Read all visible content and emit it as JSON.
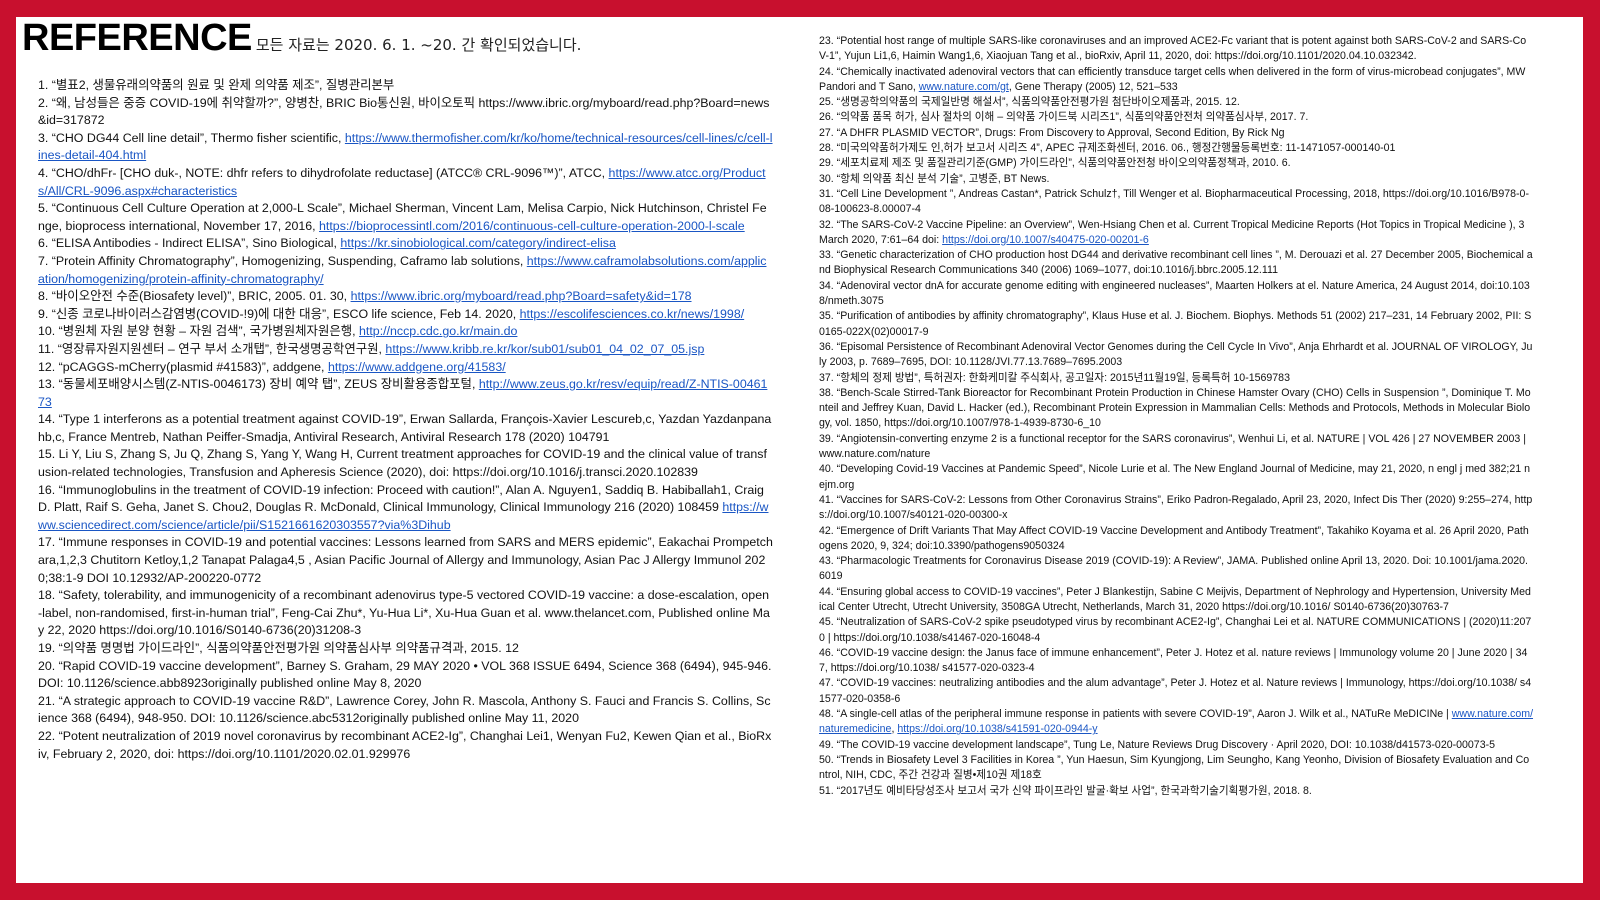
{
  "header": {
    "title": "REFERENCE",
    "subtitle": "모든 자료는 2020. 6. 1. ~20. 간 확인되었습니다."
  },
  "left_refs": [
    {
      "text": "1. “별표2, 생물유래의약품의 원료 및 완제 의약품 제조”, 질병관리본부",
      "link": ""
    },
    {
      "text": "2. “왜, 남성들은 중증 COVID-19에 취약할까?”, 양병찬, BRIC Bio통신원, 바이오토픽 https://www.ibric.org/myboard/read.php?Board=news&id=317872",
      "link": ""
    },
    {
      "text": "3. “CHO DG44 Cell line detail”, Thermo fisher scientific, ",
      "link": "https://www.thermofisher.com/kr/ko/home/technical-resources/cell-lines/c/cell-lines-detail-404.html"
    },
    {
      "text": "4. “CHO/dhFr- [CHO duk-, NOTE: dhfr refers to dihydrofolate reductase] (ATCC® CRL-9096™)”, ATCC, ",
      "link": "https://www.atcc.org/Products/All/CRL-9096.aspx#characteristics"
    },
    {
      "text": "5. “Continuous Cell Culture Operation at 2,000-L Scale”, Michael Sherman, Vincent Lam, Melisa Carpio, Nick Hutchinson, Christel Fenge, bioprocess international, November 17, 2016, ",
      "link": "https://bioprocessintl.com/2016/continuous-cell-culture-operation-2000-l-scale"
    },
    {
      "text": "6. “ELISA Antibodies - Indirect ELISA”, Sino Biological, ",
      "link": "https://kr.sinobiological.com/category/indirect-elisa"
    },
    {
      "text": "7. “Protein Affinity Chromatography”, Homogenizing, Suspending, Caframo lab solutions, ",
      "link": "https://www.caframolabsolutions.com/application/homogenizing/protein-affinity-chromatography/"
    },
    {
      "text": "8. “바이오안전 수준(Biosafety level)”, BRIC, 2005. 01. 30, ",
      "link": "https://www.ibric.org/myboard/read.php?Board=safety&id=178"
    },
    {
      "text": "9. “신종 코로나바이러스감염병(COVID-!9)에 대한 대응”, ESCO life science, Feb 14. 2020, ",
      "link": "https://escolifesciences.co.kr/news/1998/"
    },
    {
      "text": "10. “병원체 자원 분양 현황 – 자원 검색”, 국가병원체자원은행, ",
      "link": "http://nccp.cdc.go.kr/main.do"
    },
    {
      "text": "11. “영장류자원지원센터 – 연구 부서 소개탭”, 한국생명공학연구원, ",
      "link": "https://www.kribb.re.kr/kor/sub01/sub01_04_02_07_05.jsp"
    },
    {
      "text": "12. “pCAGGS-mCherry(plasmid #41583)”, addgene, ",
      "link": "https://www.addgene.org/41583/"
    },
    {
      "text": "13. “동물세포배양시스템(Z-NTIS-0046173) 장비 예약 탭”, ZEUS 장비활용종합포털, ",
      "link": "http://www.zeus.go.kr/resv/equip/read/Z-NTIS-0046173"
    },
    {
      "text": "14. “Type 1 interferons as a potential treatment against COVID-19”, Erwan Sallarda, François-Xavier Lescureb,c, Yazdan Yazdanpanahb,c, France Mentreb, Nathan Peiffer-Smadja, Antiviral Research, Antiviral Research 178 (2020) 104791",
      "link": ""
    },
    {
      "text": "15. Li Y, Liu S, Zhang S, Ju Q, Zhang S, Yang Y, Wang H, Current treatment approaches for COVID-19 and the clinical value of transfusion-related technologies, Transfusion and Apheresis Science (2020), doi: https://doi.org/10.1016/j.transci.2020.102839",
      "link": ""
    },
    {
      "text": "16. “Immunoglobulins in the treatment of COVID-19 infection: Proceed with caution!”, Alan A. Nguyen1, Saddiq B. Habiballah1, Craig D. Platt, Raif S. Geha, Janet S. Chou2, Douglas R. McDonald, Clinical Immunology, Clinical Immunology 216 (2020) 108459 ",
      "link": "https://www.sciencedirect.com/science/article/pii/S1521661620303557?via%3Dihub"
    },
    {
      "text": "17. “Immune responses in COVID-19 and potential vaccines: Lessons learned from SARS and MERS epidemic”, Eakachai Prompetchara,1,2,3 Chutitorn Ketloy,1,2 Tanapat Palaga4,5 , Asian Pacific Journal of Allergy and Immunology, Asian Pac J Allergy Immunol 2020;38:1-9 DOI 10.12932/AP-200220-0772",
      "link": ""
    },
    {
      "text": "18. “Safety, tolerability, and immunogenicity of a recombinant adenovirus type-5 vectored COVID-19 vaccine: a dose-escalation, open-label, non-randomised, first-in-human trial”, Feng-Cai Zhu*, Yu-Hua Li*, Xu-Hua Guan et al. www.thelancet.com, Published online May 22, 2020 https://doi.org/10.1016/S0140-6736(20)31208-3",
      "link": ""
    },
    {
      "text": "19. “의약품 명명법 가이드라인”, 식품의약품안전평가원 의약품심사부 의약품규격과, 2015. 12",
      "link": ""
    },
    {
      "text": "20. “Rapid COVID-19 vaccine development”, Barney S. Graham, 29 MAY 2020 • VOL 368 ISSUE 6494, Science 368 (6494), 945-946. DOI: 10.1126/science.abb8923originally published online May 8, 2020",
      "link": ""
    },
    {
      "text": "21. “A strategic approach to COVID-19 vaccine R&D”, Lawrence Corey, John R. Mascola, Anthony S. Fauci and Francis S. Collins, Science 368 (6494), 948-950. DOI: 10.1126/science.abc5312originally published online May 11, 2020",
      "link": ""
    },
    {
      "text": "22. “Potent neutralization of 2019 novel coronavirus by recombinant ACE2-Ig”, Changhai Lei1, Wenyan Fu2, Kewen Qian et al., BioRxiv, February 2, 2020, doi: https://doi.org/10.1101/2020.02.01.929976",
      "link": ""
    }
  ],
  "right_refs": [
    {
      "text": "23. “Potential host range of multiple SARS-like coronaviruses and an improved ACE2-Fc variant that is potent against both SARS-CoV-2 and SARS-CoV-1”, Yujun Li1,6, Haimin Wang1,6, Xiaojuan Tang et al., bioRxiv, April 11, 2020, doi: https://doi.org/10.1101/2020.04.10.032342.",
      "link": ""
    },
    {
      "text": "24. “Chemically inactivated adenoviral vectors that can efficiently transduce target cells when delivered in the form of virus-microbead conjugates”, MW Pandori and T Sano, ",
      "link": "www.nature.com/gt",
      "after": ", Gene Therapy (2005) 12, 521–533"
    },
    {
      "text": "25. “생명공학의약품의 국제일반명 해설서”, 식품의약품안전평가원 첨단바이오제품과, 2015. 12.",
      "link": ""
    },
    {
      "text": "26. “의약품 품목 허가, 심사 절차의 이해 – 의약품 가이드북 시리즈1”, 식품의약품안전처 의약품심사부, 2017. 7.",
      "link": ""
    },
    {
      "text": "27. “A DHFR PLASMID VECTOR”, Drugs: From Discovery to Approval, Second Edition, By Rick Ng",
      "link": ""
    },
    {
      "text": "28. “미국의약품허가제도 인,허가 보고서 시리즈 4”, APEC 규제조화센터, 2016. 06., 행정간행물등록번호: 11-1471057-000140-01",
      "link": ""
    },
    {
      "text": "29. “세포치료제 제조 및 품질관리기준(GMP) 가이드라인”, 식품의약품안전청 바이오의약품정책과, 2010. 6.",
      "link": ""
    },
    {
      "text": "30. “항체 의약품 최신 분석 기술”, 고병준, BT News.",
      "link": ""
    },
    {
      "text": "31. “Cell Line Development ”, Andreas Castan*, Patrick Schulz†, Till Wenger et al. Biopharmaceutical Processing, 2018, https://doi.org/10.1016/B978-0-08-100623-8.00007-4",
      "link": ""
    },
    {
      "text": "32. “The SARS-CoV-2 Vaccine Pipeline: an Overview”, Wen-Hsiang Chen et al. Current Tropical Medicine Reports (Hot Topics in Tropical Medicine ), 3 March 2020, 7:61–64 doi: ",
      "link": "https://doi.org/10.1007/s40475-020-00201-6"
    },
    {
      "text": "33. “Genetic characterization of CHO production host DG44 and derivative recombinant cell lines ”, M. Derouazi et al. 27 December 2005, Biochemical and Biophysical Research Communications 340 (2006) 1069–1077, doi:10.1016/j.bbrc.2005.12.111",
      "link": ""
    },
    {
      "text": "34. “Adenoviral vector dnA for accurate genome editing with engineered nucleases”, Maarten Holkers at el. Nature America, 24 August 2014, doi:10.1038/nmeth.3075",
      "link": ""
    },
    {
      "text": "35. “Purification of antibodies by affinity chromatography”, Klaus Huse et al. J. Biochem. Biophys. Methods 51 (2002) 217–231, 14 February 2002, PII: S0165-022X(02)00017-9",
      "link": ""
    },
    {
      "text": "36. “Episomal Persistence of Recombinant Adenoviral Vector Genomes during the Cell Cycle In Vivo”, Anja Ehrhardt et al. JOURNAL OF VIROLOGY, July 2003, p. 7689–7695, DOI: 10.1128/JVI.77.13.7689–7695.2003",
      "link": ""
    },
    {
      "text": "37. “항체의 정제 방법”, 특허권자: 한화케미칼 주식회사, 공고일자: 2015년11월19일, 등록특허 10-1569783",
      "link": ""
    },
    {
      "text": "38. “Bench-Scale Stirred-Tank Bioreactor for Recombinant Protein Production in Chinese Hamster Ovary (CHO) Cells in Suspension ”, Dominique T. Monteil and Jeffrey Kuan, David L. Hacker (ed.), Recombinant Protein Expression in Mammalian Cells: Methods and Protocols, Methods in Molecular Biology, vol. 1850, https://doi.org/10.1007/978-1-4939-8730-6_10",
      "link": ""
    },
    {
      "text": "39. “Angiotensin-converting enzyme 2 is a functional receptor for the SARS coronavirus”, Wenhui Li, et al. NATURE | VOL 426 | 27 NOVEMBER 2003 | www.nature.com/nature",
      "link": ""
    },
    {
      "text": "40. “Developing Covid-19 Vaccines at Pandemic Speed”, Nicole Lurie et al. The New England Journal of Medicine, may 21, 2020, n engl j med 382;21 nejm.org",
      "link": ""
    },
    {
      "text": "41. “Vaccines for SARS-CoV-2: Lessons from Other Coronavirus Strains”, Eriko Padron-Regalado, April 23, 2020, Infect Dis Ther (2020) 9:255–274, https://doi.org/10.1007/s40121-020-00300-x",
      "link": ""
    },
    {
      "text": "42. “Emergence of Drift Variants That May Affect COVID-19 Vaccine Development and Antibody Treatment”, Takahiko Koyama et al. 26 April 2020, Pathogens 2020, 9, 324; doi:10.3390/pathogens9050324",
      "link": ""
    },
    {
      "text": "43. “Pharmacologic Treatments for Coronavirus Disease 2019 (COVID-19): A Review”, JAMA. Published online April 13, 2020. Doi: 10.1001/jama.2020.6019",
      "link": ""
    },
    {
      "text": "44. “Ensuring global access to COVID-19 vaccines”, Peter J Blankestijn, Sabine C Meijvis, Department of Nephrology and Hypertension, University Medical Center Utrecht, Utrecht University, 3508GA Utrecht, Netherlands, March 31, 2020 https://doi.org/10.1016/ S0140-6736(20)30763-7",
      "link": ""
    },
    {
      "text": "45. “Neutralization of SARS-CoV-2 spike pseudotyped virus by recombinant ACE2-Ig”, Changhai Lei et al. NATURE COMMUNICATIONS | (2020)11:2070 | https://doi.org/10.1038/s41467-020-16048-4",
      "link": ""
    },
    {
      "text": "46. “COVID-19 vaccine design: the Janus face of immune enhancement”, Peter J. Hotez et al. nature reviews | Immunology volume 20 | June 2020 | 347, https://doi.org/10.1038/ s41577-020-0323-4",
      "link": ""
    },
    {
      "text": "47. “COVID-19 vaccines: neutralizing antibodies and the alum advantage”, Peter J. Hotez et al. Nature reviews | Immunology, https://doi.org/10.1038/ s41577-020-0358-6",
      "link": ""
    },
    {
      "text": "48. “A single-cell atlas of the peripheral immune response in patients with severe COVID-19”, Aaron J. Wilk et al., NATuRe MeDICINe | ",
      "link": "www.nature.com/naturemedicine",
      "after": ", ",
      "link2": "https://doi.org/10.1038/s41591-020-0944-y"
    },
    {
      "text": "49. “The COVID-19 vaccine development landscape”, Tung Le, Nature Reviews Drug Discovery · April 2020, DOI: 10.1038/d41573-020-00073-5",
      "link": ""
    },
    {
      "text": "50. “Trends in Biosafety Level 3 Facilities in Korea ”, Yun Haesun, Sim Kyungjong, Lim Seungho, Kang Yeonho, Division of Biosafety Evaluation and Control, NIH, CDC, 주간 건강과 질병•제10권 제18호",
      "link": ""
    },
    {
      "text": "51. “2017년도 예비타당성조사 보고서 국가 신약 파이프라인 발굴·확보 사업”, 한국과학기술기획평가원, 2018. 8.",
      "link": ""
    }
  ]
}
